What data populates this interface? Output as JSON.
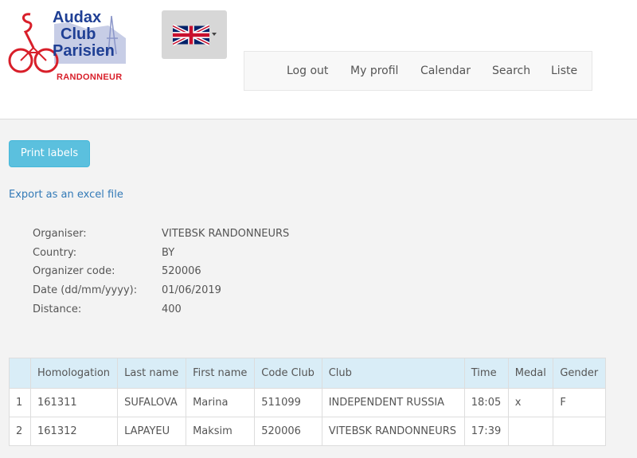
{
  "logo": {
    "line1": "Audax",
    "line2": "Club",
    "line3": "Parisien",
    "tagline": "RANDONNEUR"
  },
  "language": {
    "icon": "uk-flag-icon"
  },
  "nav": {
    "logout": "Log out",
    "profile": "My profil",
    "calendar": "Calendar",
    "search": "Search",
    "list": "Liste"
  },
  "actions": {
    "print_labels": "Print labels",
    "export_excel": "Export as an excel file"
  },
  "info": {
    "organiser_label": "Organiser:",
    "organiser_value": "VITEBSK RANDONNEURS",
    "country_label": "Country:",
    "country_value": "BY",
    "code_label": "Organizer code:",
    "code_value": "520006",
    "date_label": "Date (dd/mm/yyyy):",
    "date_value": "01/06/2019",
    "distance_label": "Distance:",
    "distance_value": "400"
  },
  "table": {
    "headers": [
      "",
      "Homologation",
      "Last name",
      "First name",
      "Code Club",
      "Club",
      "Time",
      "Medal",
      "Gender"
    ],
    "rows": [
      [
        "1",
        "161311",
        "SUFALOVA",
        "Marina",
        "511099",
        "INDEPENDENT RUSSIA",
        "18:05",
        "x",
        "F"
      ],
      [
        "2",
        "161312",
        "LAPAYEU",
        "Maksim",
        "520006",
        "VITEBSK RANDONNEURS",
        "17:39",
        "",
        ""
      ]
    ]
  },
  "colors": {
    "accent": "#5bc0de",
    "link": "#337ab7",
    "table_header": "#d9edf7",
    "logo_blue": "#1f3f94",
    "logo_red": "#d81f2a"
  }
}
